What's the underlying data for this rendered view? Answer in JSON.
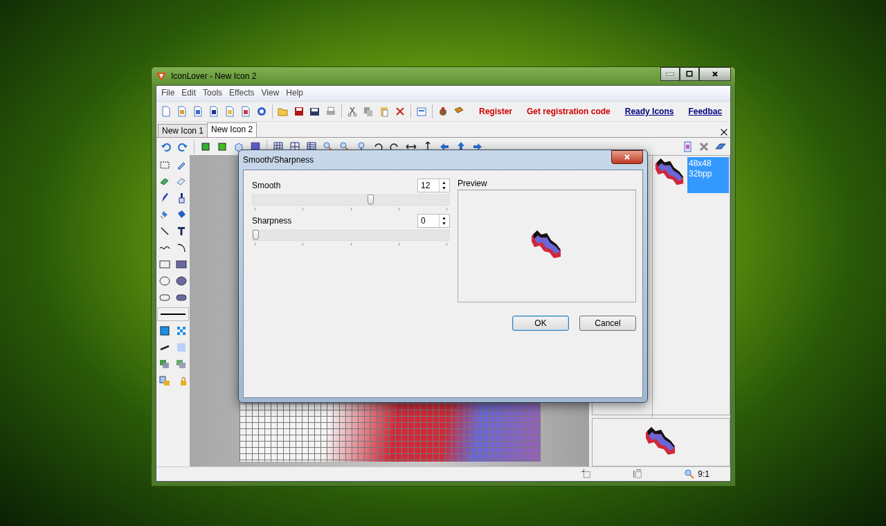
{
  "window": {
    "title": "IconLover - New Icon 2"
  },
  "menu": [
    "File",
    "Edit",
    "Tools",
    "Effects",
    "View",
    "Help"
  ],
  "toolbar_links": [
    {
      "label": "Register",
      "kind": "action"
    },
    {
      "label": "Get registration code",
      "kind": "action"
    },
    {
      "label": "Ready Icons",
      "kind": "link"
    },
    {
      "label": "Feedbac",
      "kind": "link"
    }
  ],
  "tabs": [
    {
      "label": "New Icon 1",
      "selected": false
    },
    {
      "label": "New Icon 2",
      "selected": true
    }
  ],
  "formats": [
    {
      "size": "48x48",
      "depth": "32bpp",
      "selected": true
    }
  ],
  "status_bar": {
    "zoom": "9:1"
  },
  "dialog": {
    "title": "Smooth/Sharpness",
    "sliders": [
      {
        "label": "Smooth",
        "value": "12",
        "level": 0.6
      },
      {
        "label": "Sharpness",
        "value": "0",
        "level": 0
      }
    ],
    "preview_label": "Preview",
    "buttons": [
      {
        "label": "OK",
        "default": true
      },
      {
        "label": "Cancel",
        "default": false
      }
    ]
  }
}
